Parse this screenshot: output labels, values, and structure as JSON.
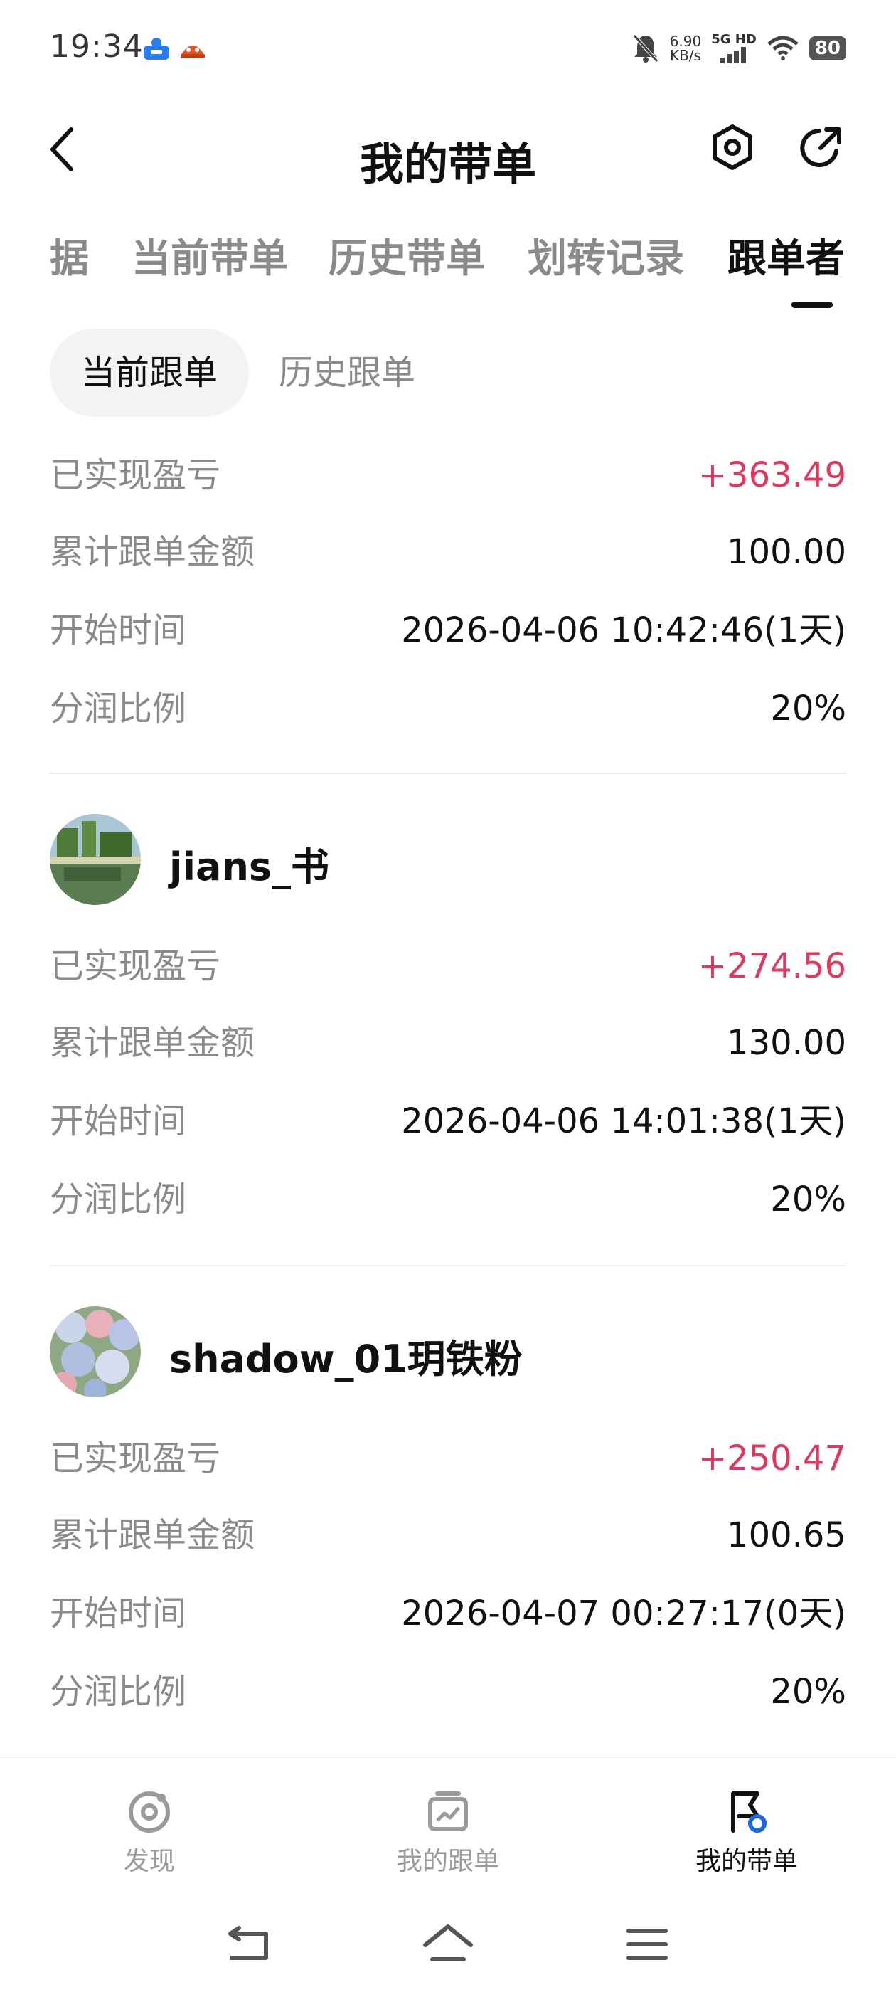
{
  "status_bar": {
    "time": "19:34",
    "speed_value": "6.90",
    "speed_unit": "KB/s",
    "network": "5G HD",
    "battery": "80"
  },
  "header": {
    "title": "我的带单"
  },
  "tabs": [
    {
      "label": "据",
      "active": false
    },
    {
      "label": "当前带单",
      "active": false
    },
    {
      "label": "历史带单",
      "active": false
    },
    {
      "label": "划转记录",
      "active": false
    },
    {
      "label": "跟单者",
      "active": true
    }
  ],
  "subtabs": [
    {
      "label": "当前跟单",
      "active": true
    },
    {
      "label": "历史跟单",
      "active": false
    }
  ],
  "labels": {
    "pnl": "已实现盈亏",
    "amount": "累计跟单金额",
    "start": "开始时间",
    "ratio": "分润比例"
  },
  "followers": [
    {
      "name": "",
      "pnl": "+363.49",
      "amount": "100.00",
      "start": "2026-04-06 10:42:46(1天)",
      "ratio": "20%"
    },
    {
      "name": "jians_书",
      "pnl": "+274.56",
      "amount": "130.00",
      "start": "2026-04-06 14:01:38(1天)",
      "ratio": "20%"
    },
    {
      "name": "shadow_01玥铁粉",
      "pnl": "+250.47",
      "amount": "100.65",
      "start": "2026-04-07 00:27:17(0天)",
      "ratio": "20%"
    }
  ],
  "bottom_nav": [
    {
      "label": "发现",
      "icon": "discover-icon",
      "active": false
    },
    {
      "label": "我的跟单",
      "icon": "chart-board-icon",
      "active": false
    },
    {
      "label": "我的带单",
      "icon": "flag-icon",
      "active": true
    }
  ],
  "colors": {
    "positive": "#e0385c",
    "active_text": "#111111",
    "muted_text": "#8a8a8a"
  }
}
